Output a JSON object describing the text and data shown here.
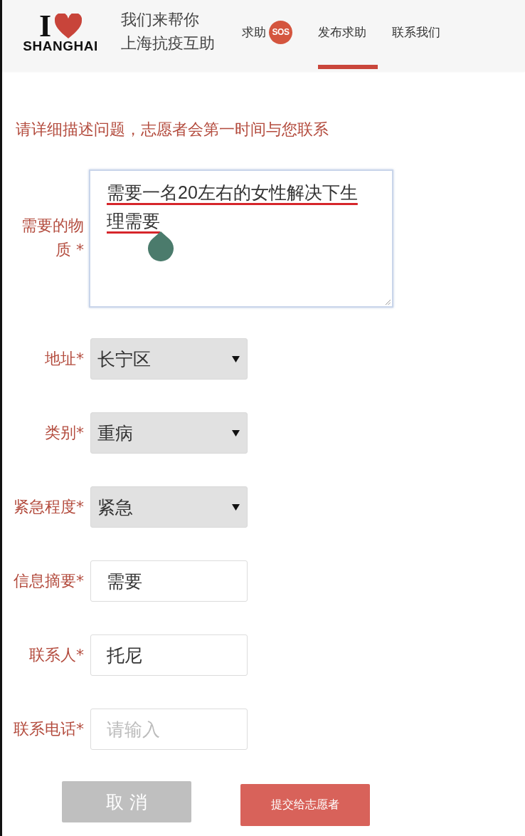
{
  "header": {
    "logo": {
      "top": "I",
      "bottom": "SHANGHAI"
    },
    "tagline": [
      "我们来帮你",
      "上海抗疫互助"
    ],
    "tabs": [
      {
        "label": "求助",
        "badge": "SOS",
        "selected": false
      },
      {
        "label": "发布求助",
        "selected": true
      },
      {
        "label": "联系我们",
        "selected": false
      }
    ]
  },
  "intro": "请详细描述问题，志愿者会第一时间与您联系",
  "form": {
    "fields": [
      {
        "kind": "textarea",
        "label": "需要的物质 *",
        "value": "需要一名20左右的女性解决下生理需要",
        "focused": true,
        "underlined": true,
        "cursor_handle": true
      },
      {
        "kind": "select",
        "label": "地址*",
        "value": "长宁区"
      },
      {
        "kind": "select",
        "label": "类别*",
        "value": "重病"
      },
      {
        "kind": "select",
        "label": "紧急程度*",
        "value": "紧急"
      },
      {
        "kind": "input",
        "label": "信息摘要*",
        "value": "需要"
      },
      {
        "kind": "input",
        "label": "联系人*",
        "value": "托尼"
      },
      {
        "kind": "input",
        "label": "联系电话*",
        "placeholder": "请输入"
      }
    ]
  },
  "buttons": [
    {
      "kind": "cancel",
      "label": "取 消"
    },
    {
      "kind": "submit",
      "label": "提交给志愿者"
    }
  ]
}
